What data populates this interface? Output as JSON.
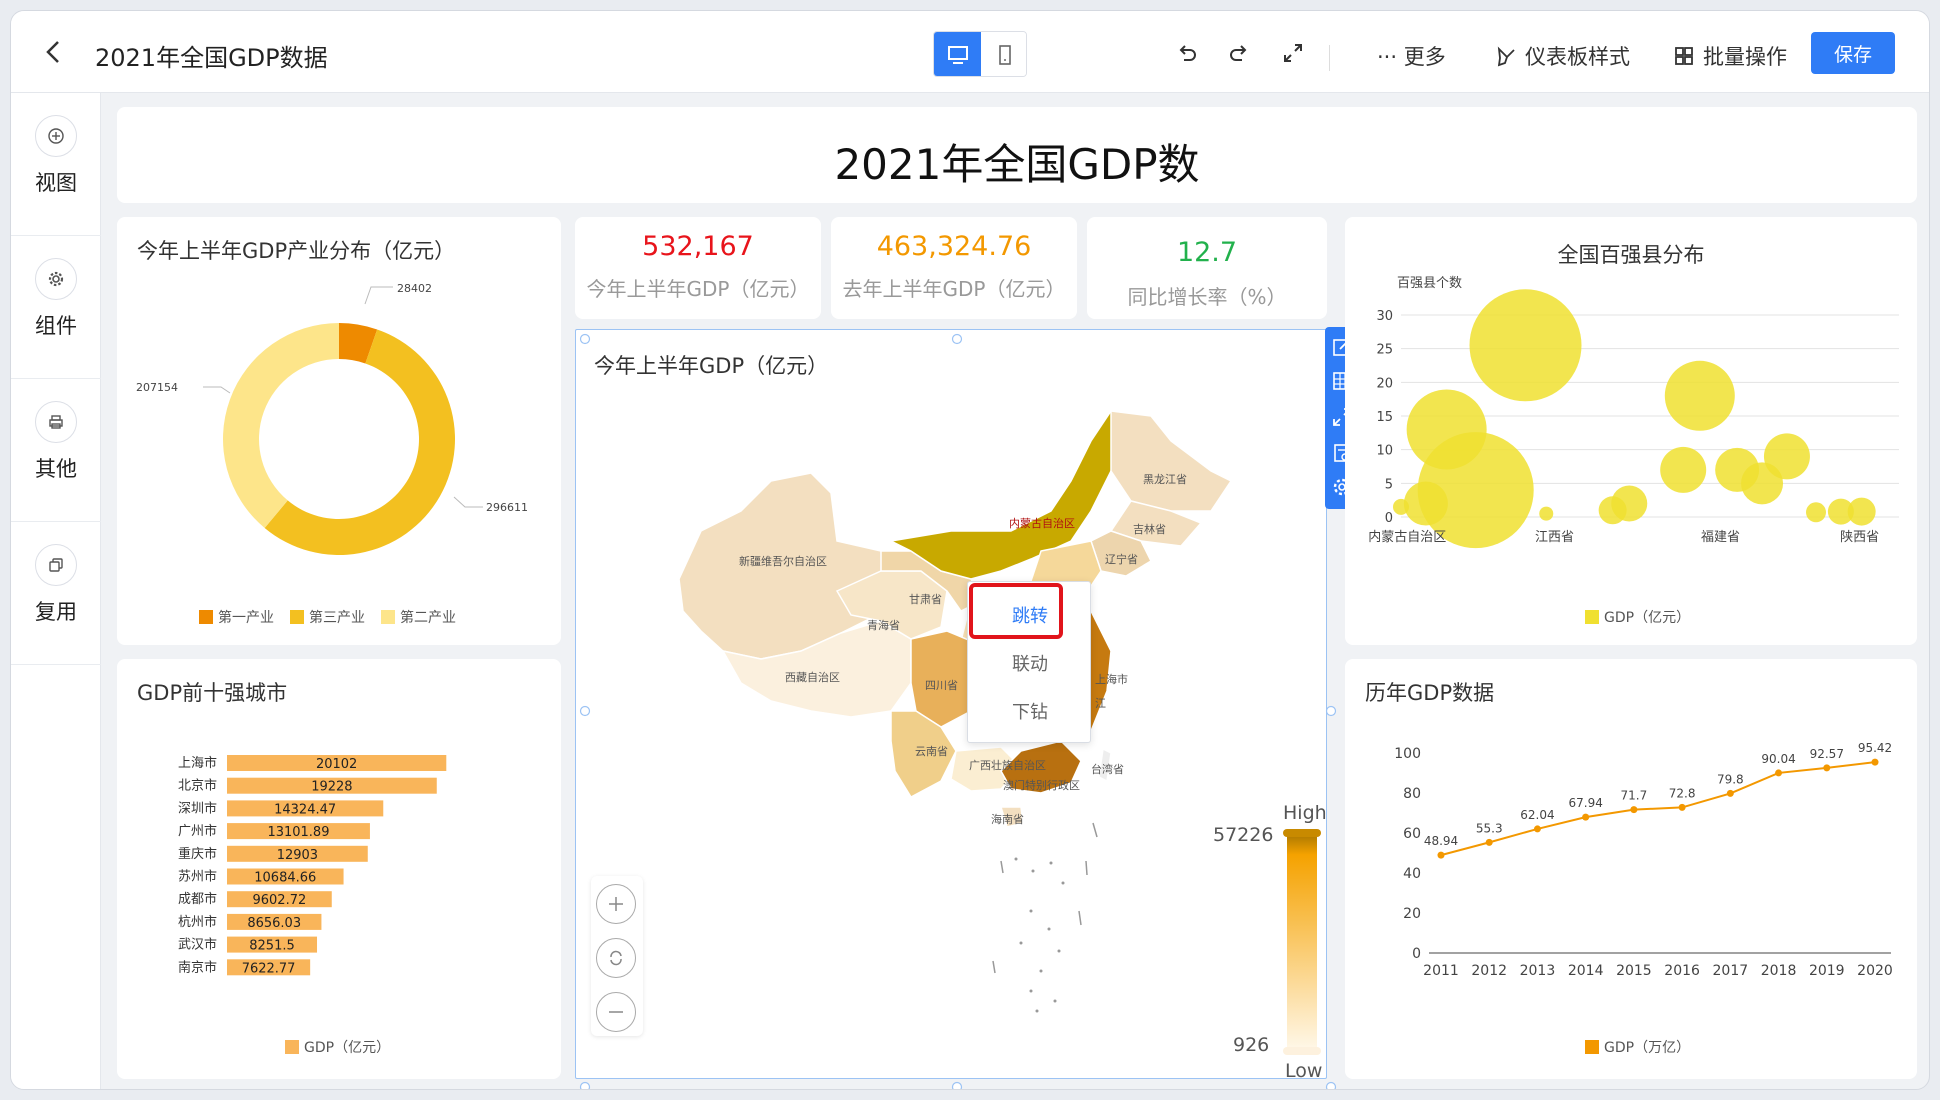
{
  "topbar": {
    "title": "2021年全国GDP数据",
    "more_label": "··· 更多",
    "style_label": "仪表板样式",
    "batch_label": "批量操作",
    "save_label": "保存"
  },
  "rail": [
    {
      "label": "视图",
      "icon": "plus-circle-icon"
    },
    {
      "label": "组件",
      "icon": "gear-icon"
    },
    {
      "label": "其他",
      "icon": "printer-icon"
    },
    {
      "label": "复用",
      "icon": "copy-icon"
    }
  ],
  "dashboard": {
    "title": "2021年全国GDP数"
  },
  "kpis": [
    {
      "value": "532,167",
      "label": "今年上半年GDP（亿元）",
      "color": "#e8141b"
    },
    {
      "value": "463,324.76",
      "label": "去年上半年GDP（亿元）",
      "color": "#f39800"
    },
    {
      "value": "12.7",
      "label": "同比增长率（%）",
      "color": "#22b14c"
    }
  ],
  "donut": {
    "title": "今年上半年GDP产业分布（亿元）",
    "legend": [
      {
        "label": "第一产业",
        "color": "#ee8a00"
      },
      {
        "label": "第三产业",
        "color": "#f3c020"
      },
      {
        "label": "第二产业",
        "color": "#fde58a"
      }
    ],
    "labels": {
      "first": "28402",
      "second": "207154",
      "third": "296611"
    }
  },
  "map": {
    "title": "今年上半年GDP（亿元）",
    "max": "57226",
    "min": "926",
    "high": "High",
    "low": "Low",
    "provinces": {
      "xinjiang": "新疆维吾尔自治区",
      "xizang": "西藏自治区",
      "qinghai": "青海省",
      "gansu": "甘肃省",
      "neimenggu": "内蒙古自治区",
      "heilongjiang": "黑龙江省",
      "jilin": "吉林省",
      "liaoning": "辽宁省",
      "sichuan": "四川省",
      "yunnan": "云南省",
      "guangxi": "广西壮族自治区",
      "guangdong": "广东省",
      "hainan": "海南省",
      "taiwan": "台湾省",
      "aomen": "澳门特别行政区",
      "shanghai": "上海市",
      "jiangsu": "江"
    },
    "context_menu": [
      "跳转",
      "联动",
      "下钻"
    ]
  },
  "bar": {
    "title": "GDP前十强城市",
    "legend": "GDP（亿元）",
    "color": "#f9b55a"
  },
  "bubble": {
    "title": "全国百强县分布",
    "y_axis_title": "百强县个数",
    "legend": "GDP（亿元）",
    "color": "#f0e030"
  },
  "line": {
    "title": "历年GDP数据",
    "legend": "GDP（万亿）",
    "color": "#f39800"
  },
  "chart_data": [
    {
      "type": "pie",
      "title": "今年上半年GDP产业分布（亿元）",
      "categories": [
        "第一产业",
        "第三产业",
        "第二产业"
      ],
      "values": [
        28402,
        296611,
        207154
      ]
    },
    {
      "type": "bar",
      "title": "GDP前十强城市",
      "categories": [
        "上海市",
        "北京市",
        "深圳市",
        "广州市",
        "重庆市",
        "苏州市",
        "成都市",
        "杭州市",
        "武汉市",
        "南京市"
      ],
      "values": [
        20102,
        19228,
        14324.47,
        13101.89,
        12903,
        10684.66,
        9602.72,
        8656.03,
        8251.5,
        7622.77
      ],
      "value_labels": [
        "20102",
        "19228",
        "14324.47",
        "13101.89",
        "12903",
        "10684.66",
        "9602.72",
        "8656.03",
        "8251.5",
        "7622.77"
      ],
      "xlim": [
        0,
        22000
      ],
      "series": [
        {
          "name": "GDP（亿元）"
        }
      ]
    },
    {
      "type": "scatter",
      "title": "全国百强县分布",
      "ylabel": "百强县个数",
      "ylim": [
        0,
        30
      ],
      "y_ticks": [
        "0",
        "5",
        "10",
        "15",
        "20",
        "25",
        "30"
      ],
      "x_tick_labels": [
        "内蒙古自治区",
        "江西省",
        "福建省",
        "陕西省"
      ],
      "points": [
        {
          "x": 0,
          "y": 1.5,
          "size": 8
        },
        {
          "x": 0.6,
          "y": 2,
          "size": 22
        },
        {
          "x": 1.1,
          "y": 13,
          "size": 40
        },
        {
          "x": 1.8,
          "y": 4,
          "size": 58
        },
        {
          "x": 3.5,
          "y": 0.5,
          "size": 7
        },
        {
          "x": 5.1,
          "y": 1,
          "size": 14
        },
        {
          "x": 5.5,
          "y": 2,
          "size": 18
        },
        {
          "x": 3.0,
          "y": 25.5,
          "size": 56
        },
        {
          "x": 7.2,
          "y": 18,
          "size": 35
        },
        {
          "x": 6.8,
          "y": 7,
          "size": 23
        },
        {
          "x": 8.1,
          "y": 7,
          "size": 22
        },
        {
          "x": 8.7,
          "y": 5,
          "size": 21
        },
        {
          "x": 9.3,
          "y": 9,
          "size": 23
        },
        {
          "x": 10.0,
          "y": 0.7,
          "size": 10
        },
        {
          "x": 10.6,
          "y": 0.8,
          "size": 13
        },
        {
          "x": 11.1,
          "y": 0.8,
          "size": 14
        }
      ],
      "series": [
        {
          "name": "GDP（亿元）"
        }
      ]
    },
    {
      "type": "line",
      "title": "历年GDP数据",
      "x": [
        "2011",
        "2012",
        "2013",
        "2014",
        "2015",
        "2016",
        "2017",
        "2018",
        "2019",
        "2020"
      ],
      "values": [
        48.94,
        55.3,
        62.04,
        67.94,
        71.7,
        72.8,
        79.8,
        90.04,
        92.57,
        95.42
      ],
      "value_labels": [
        "48.94",
        "55.3",
        "62.04",
        "67.94",
        "71.7",
        "72.8",
        "79.8",
        "90.04",
        "92.57",
        "95.42"
      ],
      "ylim": [
        0,
        100
      ],
      "y_ticks": [
        "0",
        "20",
        "40",
        "60",
        "80",
        "100"
      ],
      "series": [
        {
          "name": "GDP（万亿）"
        }
      ]
    }
  ]
}
